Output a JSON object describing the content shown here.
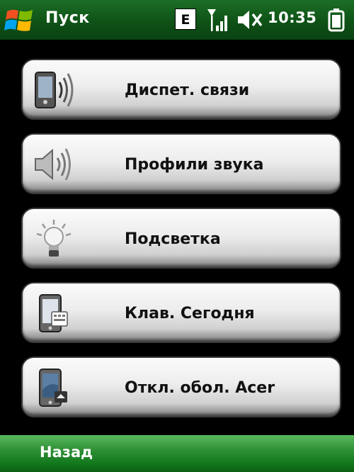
{
  "status_bar": {
    "title": "Пуск",
    "network_badge": "E",
    "time": "10:35",
    "icons": [
      "windows-start-icon",
      "signal-strength-icon",
      "volume-muted-icon",
      "battery-icon"
    ]
  },
  "menu": {
    "items": [
      {
        "label": "Диспет. связи",
        "icon": "connection-manager-icon"
      },
      {
        "label": "Профили звука",
        "icon": "sound-profiles-icon"
      },
      {
        "label": "Подсветка",
        "icon": "backlight-bulb-icon"
      },
      {
        "label": "Клав. Сегодня",
        "icon": "today-keyboard-icon"
      },
      {
        "label": "Откл. обол. Acer",
        "icon": "acer-shell-off-icon"
      }
    ]
  },
  "softkeys": {
    "left": "Назад"
  },
  "colors": {
    "statusbar_green": "#0f5217",
    "softkey_green": "#2f9036"
  }
}
